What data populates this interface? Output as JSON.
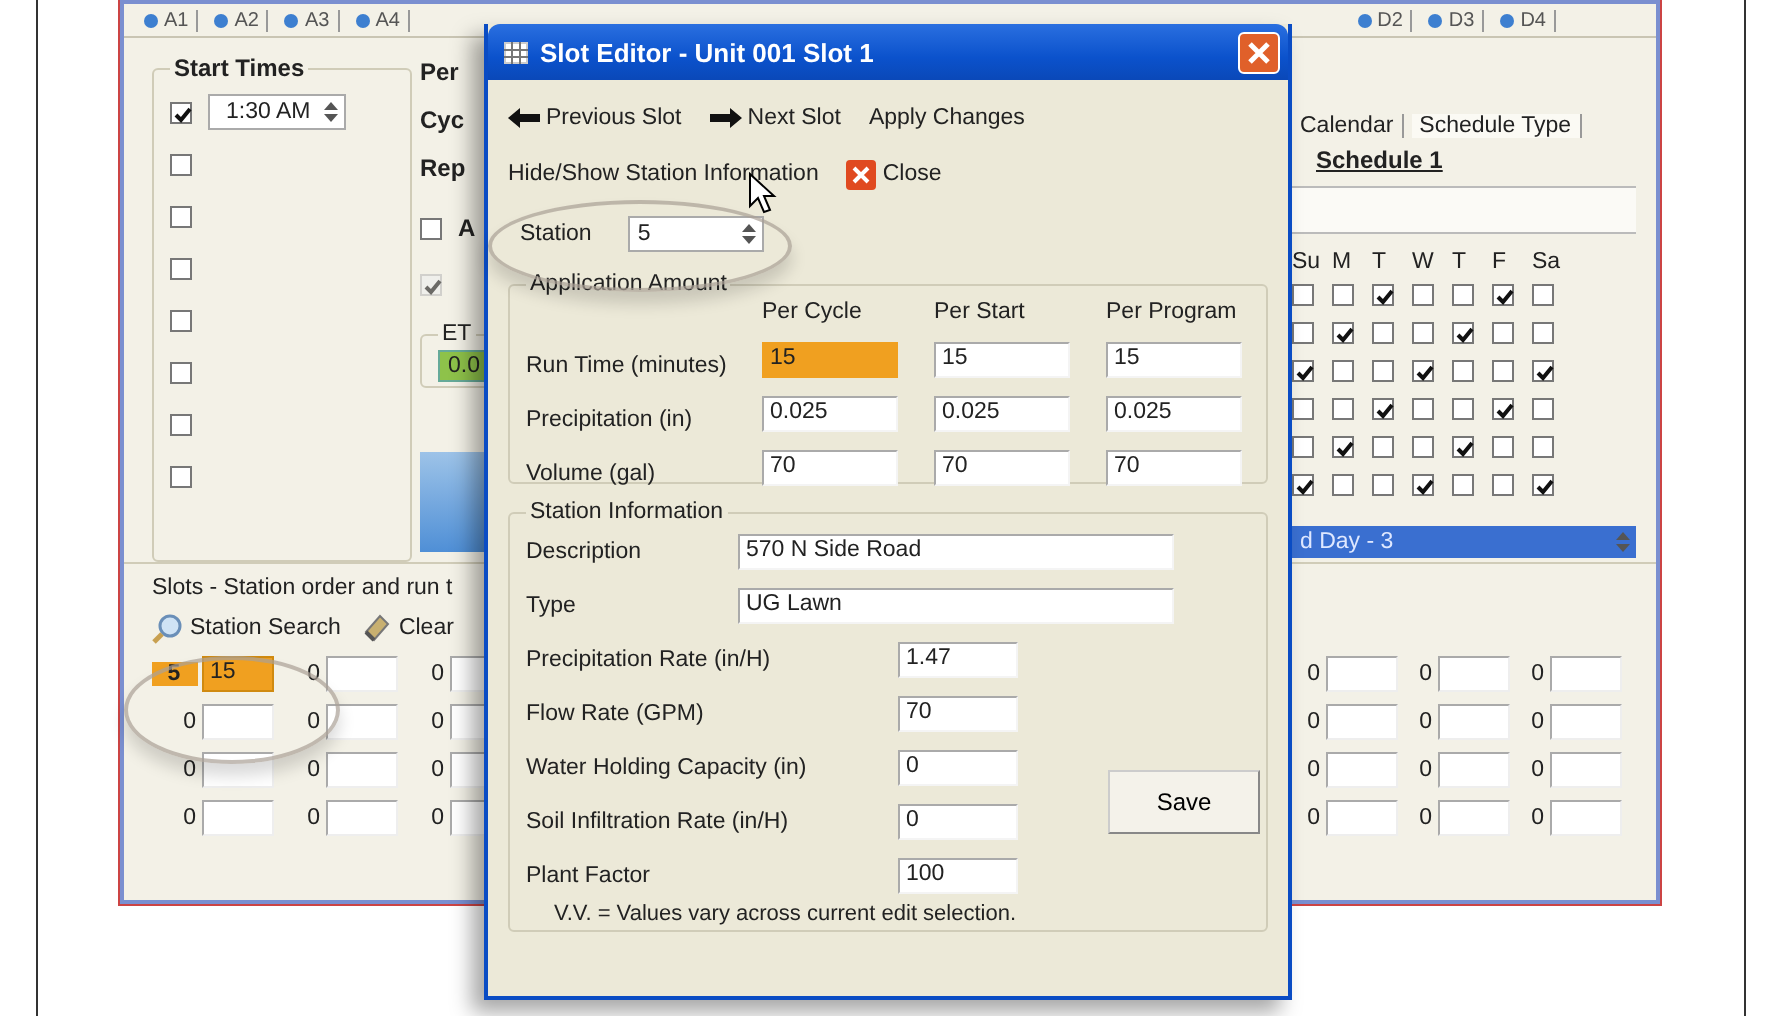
{
  "program_tabs_left": [
    {
      "label": "A1"
    },
    {
      "label": "A2"
    },
    {
      "label": "A3"
    },
    {
      "label": "A4"
    }
  ],
  "program_tabs_right": [
    {
      "label": "D2"
    },
    {
      "label": "D3"
    },
    {
      "label": "D4"
    }
  ],
  "start_times": {
    "title": "Start Times",
    "rows": [
      {
        "checked": true,
        "time": "1:30 AM"
      },
      {
        "checked": false
      },
      {
        "checked": false
      },
      {
        "checked": false
      },
      {
        "checked": false
      },
      {
        "checked": false
      },
      {
        "checked": false
      },
      {
        "checked": false
      }
    ]
  },
  "middle_panel": {
    "labels": [
      "Per",
      "Cyc",
      "Rep"
    ],
    "option": {
      "label": "A",
      "checked": false
    },
    "disabled_option": {
      "checked": true,
      "disabled": true
    },
    "et_group": {
      "title": "ET",
      "value": "0.0"
    }
  },
  "schedule_panel": {
    "tabs": [
      {
        "label": "Calendar",
        "selected": false
      },
      {
        "label": "Schedule Type",
        "selected": true
      }
    ],
    "title": "Schedule 1",
    "day_headers": [
      "Su",
      "M",
      "T",
      "W",
      "T",
      "F",
      "Sa"
    ],
    "rows": [
      [
        {
          "checked": false
        },
        {
          "checked": false
        },
        {
          "checked": true
        },
        {
          "checked": false
        },
        {
          "checked": false
        },
        {
          "checked": true
        },
        {
          "checked": false
        }
      ],
      [
        {
          "checked": false
        },
        {
          "checked": true
        },
        {
          "checked": false
        },
        {
          "checked": false
        },
        {
          "checked": true
        },
        {
          "checked": false
        },
        {
          "checked": false
        }
      ],
      [
        {
          "checked": true
        },
        {
          "checked": false
        },
        {
          "checked": false
        },
        {
          "checked": true
        },
        {
          "checked": false
        },
        {
          "checked": false
        },
        {
          "checked": true
        }
      ],
      [
        {
          "checked": false
        },
        {
          "checked": false
        },
        {
          "checked": true
        },
        {
          "checked": false
        },
        {
          "checked": false
        },
        {
          "checked": true
        },
        {
          "checked": false
        }
      ],
      [
        {
          "checked": false
        },
        {
          "checked": true
        },
        {
          "checked": false
        },
        {
          "checked": false
        },
        {
          "checked": true
        },
        {
          "checked": false
        },
        {
          "checked": false
        }
      ],
      [
        {
          "checked": true
        },
        {
          "checked": false
        },
        {
          "checked": false
        },
        {
          "checked": true
        },
        {
          "checked": false
        },
        {
          "checked": false
        },
        {
          "checked": true
        }
      ]
    ],
    "selected_item": "d Day - 3"
  },
  "slots": {
    "title": "Slots - Station order and run t",
    "buttons": [
      {
        "kind": "search",
        "label": "Station Search"
      },
      {
        "kind": "clear",
        "label": "Clear"
      }
    ],
    "left_rows": [
      [
        {
          "number": "5",
          "value": "15",
          "highlighted": true
        },
        {
          "number": "0",
          "highlighted": false
        },
        {
          "number": "0",
          "highlighted": false
        }
      ],
      [
        {
          "number": "0",
          "highlighted": false
        },
        {
          "number": "0",
          "highlighted": false
        },
        {
          "number": "0",
          "highlighted": false
        }
      ],
      [
        {
          "number": "0",
          "highlighted": false
        },
        {
          "number": "0",
          "highlighted": false
        },
        {
          "number": "0",
          "highlighted": false
        }
      ],
      [
        {
          "number": "0",
          "highlighted": false
        },
        {
          "number": "0",
          "highlighted": false
        },
        {
          "number": "0",
          "highlighted": false
        }
      ]
    ],
    "right_rows": [
      [
        {
          "number": "0",
          "highlighted": false
        },
        {
          "number": "0",
          "highlighted": false
        },
        {
          "number": "0",
          "highlighted": false
        }
      ],
      [
        {
          "number": "0",
          "highlighted": false
        },
        {
          "number": "0",
          "highlighted": false
        },
        {
          "number": "0",
          "highlighted": false
        }
      ],
      [
        {
          "number": "0",
          "highlighted": false
        },
        {
          "number": "0",
          "highlighted": false
        },
        {
          "number": "0",
          "highlighted": false
        }
      ],
      [
        {
          "number": "0",
          "highlighted": false
        },
        {
          "number": "0",
          "highlighted": false
        },
        {
          "number": "0",
          "highlighted": false
        }
      ]
    ]
  },
  "dialog": {
    "title": "Slot Editor - Unit 001 Slot 1",
    "toolbar": [
      {
        "kind": "previous",
        "label": "Previous Slot"
      },
      {
        "kind": "next",
        "label": "Next Slot"
      },
      {
        "kind": "plain",
        "label": "Apply Changes"
      }
    ],
    "toolbar2": [
      {
        "kind": "plain",
        "label": "Hide/Show Station Information"
      },
      {
        "kind": "close",
        "label": "Close"
      }
    ],
    "station": {
      "label": "Station",
      "value": "5"
    },
    "application": {
      "title": "Application Amount",
      "columns": [
        "Per Cycle",
        "Per Start",
        "Per Program"
      ],
      "rows": [
        {
          "label": "Run Time (minutes)",
          "values": [
            {
              "value": "15",
              "highlighted": true
            },
            {
              "value": "15",
              "highlighted": false
            },
            {
              "value": "15",
              "highlighted": false
            }
          ]
        },
        {
          "label": "Precipitation (in)",
          "values": [
            {
              "value": "0.025",
              "highlighted": false
            },
            {
              "value": "0.025",
              "highlighted": false
            },
            {
              "value": "0.025",
              "highlighted": false
            }
          ]
        },
        {
          "label": "Volume (gal)",
          "values": [
            {
              "value": "70",
              "highlighted": false
            },
            {
              "value": "70",
              "highlighted": false
            },
            {
              "value": "70",
              "highlighted": false
            }
          ]
        }
      ]
    },
    "station_info": {
      "title": "Station Information",
      "text_fields": [
        {
          "label": "Description",
          "value": "570 N Side Road"
        },
        {
          "label": "Type",
          "value": "UG Lawn"
        }
      ],
      "number_fields": [
        {
          "label": "Precipitation Rate (in/H)",
          "value": "1.47"
        },
        {
          "label": "Flow Rate (GPM)",
          "value": "70"
        },
        {
          "label": "Water Holding Capacity (in)",
          "value": "0"
        },
        {
          "label": "Soil Infiltration Rate (in/H)",
          "value": "0"
        },
        {
          "label": "Plant Factor",
          "value": "100"
        }
      ],
      "save_button": "Save",
      "note": "V.V. = Values vary across current edit selection."
    }
  }
}
